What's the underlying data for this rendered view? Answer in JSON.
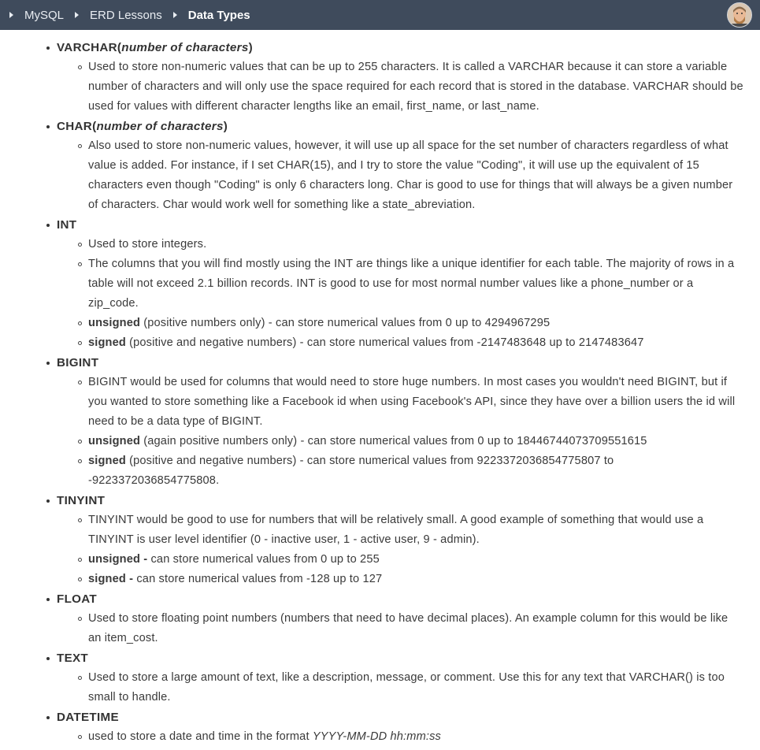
{
  "breadcrumb": [
    "MySQL",
    "ERD Lessons",
    "Data Types"
  ],
  "types": [
    {
      "name": "VARCHAR(",
      "name_italic": "number of characters",
      "name_close": ")",
      "items": [
        {
          "text": "Used to store non-numeric values that can be up to 255 characters. It is called a VARCHAR because it can store a variable number of characters and will only use the space required for each record that is stored in the database. VARCHAR should be used for values with different character lengths like an email, first_name, or last_name."
        }
      ]
    },
    {
      "name": "CHAR(",
      "name_italic": "number of characters",
      "name_close": ")",
      "items": [
        {
          "text": "Also used to store non-numeric values, however, it will use up all space for the set number of characters regardless of what value is added. For instance, if I set CHAR(15), and I try to store the value \"Coding\", it will use up the equivalent of 15 characters even though \"Coding\" is only 6 characters long. Char is good to use for things that will always be a given number of characters. Char would work well for something like a state_abreviation."
        }
      ]
    },
    {
      "name": "INT",
      "items": [
        {
          "text": "Used to store integers."
        },
        {
          "text": "The columns that you will find mostly using the INT are things like a unique identifier for each table. The majority of rows in a table will not exceed 2.1 billion records. INT is good to use for most normal number values like a phone_number or a zip_code."
        },
        {
          "bold": "unsigned",
          "text": " (positive numbers only) - can store numerical values from 0 up to 4294967295"
        },
        {
          "bold": "signed",
          "text": " (positive and negative numbers) - can store numerical values from -2147483648 up to 2147483647"
        }
      ]
    },
    {
      "name": "BIGINT",
      "items": [
        {
          "text": "BIGINT would be used for columns that would need to store huge numbers. In most cases you wouldn't need BIGINT, but if you wanted to store something like a Facebook id when using Facebook's API, since they have over a billion users the id will need to be a data type of BIGINT."
        },
        {
          "bold": "unsigned",
          "text": " (again positive numbers only) - can store numerical values from 0 up to 18446744073709551615"
        },
        {
          "bold": "signed",
          "text": " (positive and negative numbers) - can store numerical values from 9223372036854775807 to -9223372036854775808."
        }
      ]
    },
    {
      "name": "TINYINT",
      "items": [
        {
          "text": "TINYINT would be good to use for numbers that will be relatively small. A good example of something that would use a TINYINT is user level identifier (0 - inactive user, 1 - active user, 9 - admin)."
        },
        {
          "bold": "unsigned -",
          "text": " can store numerical values from 0 up to 255"
        },
        {
          "bold": "signed -",
          "text": " can store numerical values from -128 up to 127"
        }
      ]
    },
    {
      "name": "FLOAT",
      "items": [
        {
          "text": "Used to store floating point numbers (numbers that need to have decimal places). An example column for this would be like an item_cost."
        }
      ]
    },
    {
      "name": "TEXT",
      "items": [
        {
          "text": "Used to store a large amount of text, like a description, message, or comment. Use this for any text that VARCHAR() is too small to handle."
        }
      ]
    },
    {
      "name": "DATETIME",
      "items": [
        {
          "text": "used to store a date and time in the format ",
          "italic": "YYYY-MM-DD hh:mm:ss"
        }
      ]
    }
  ]
}
